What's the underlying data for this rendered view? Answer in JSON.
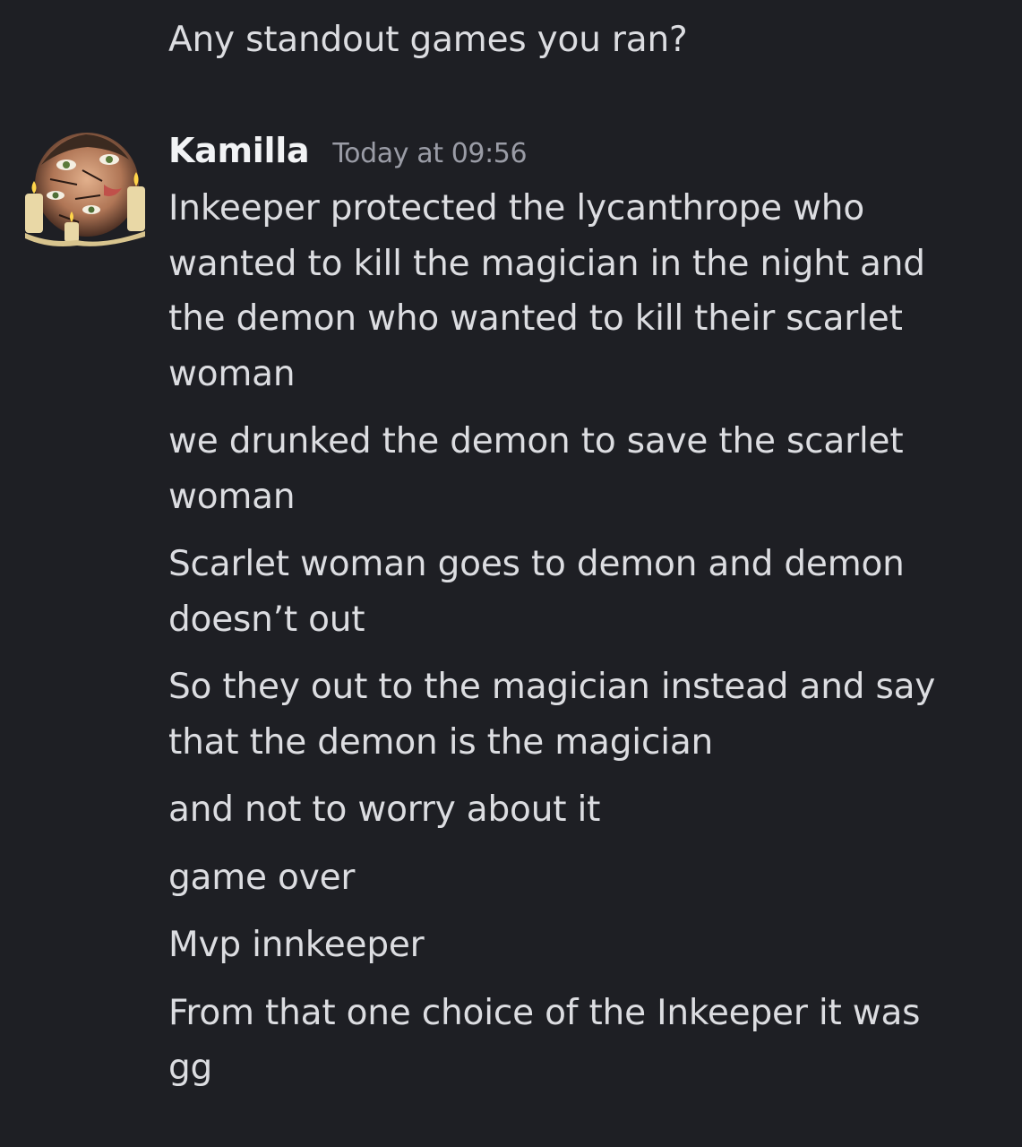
{
  "previous_message": {
    "text": "Any standout games you ran?"
  },
  "message_group": {
    "author": "Kamilla",
    "timestamp": "Today at 09:56",
    "avatar_icon": "user-avatar-art",
    "messages": [
      "Inkeeper protected the lycanthrope who\nwanted to kill the magician in the night and\nthe demon who wanted to kill their scarlet\nwoman",
      "we drunked the demon to save the scarlet\nwoman",
      "Scarlet woman goes to demon and demon\ndoesn’t out",
      "So they out to the magician instead and say\nthat the demon is the magician",
      "and not to worry about it",
      "game over",
      "Mvp innkeeper",
      "From that one choice of the Inkeeper it was\ngg"
    ]
  },
  "colors": {
    "background": "#1e1f24",
    "text": "#dcdde1",
    "username": "#f2f3f5",
    "timestamp": "#9a9ca6"
  }
}
